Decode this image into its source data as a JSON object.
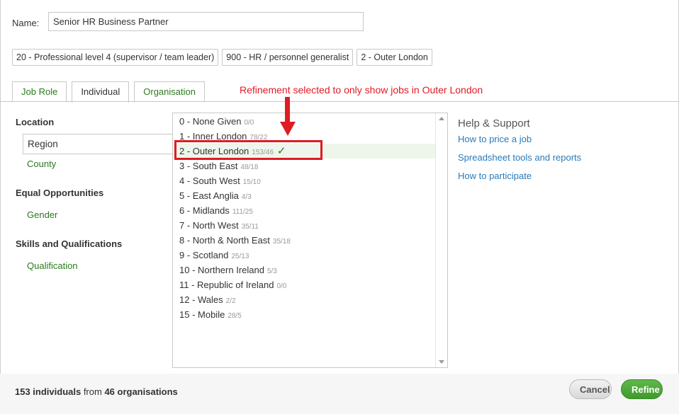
{
  "name_field": {
    "label": "Name:",
    "value": "Senior HR Business Partner"
  },
  "chips": [
    "20 - Professional level 4 (supervisor / team leader)",
    "900 - HR / personnel generalist",
    "2 - Outer London"
  ],
  "tabs": [
    {
      "label": "Job Role",
      "active": false
    },
    {
      "label": "Individual",
      "active": true
    },
    {
      "label": "Organisation",
      "active": false
    }
  ],
  "annotation": "Refinement selected to only show jobs in Outer London",
  "filters": {
    "location_heading": "Location",
    "region": "Region",
    "county": "County",
    "equal_heading": "Equal Opportunities",
    "gender": "Gender",
    "skills_heading": "Skills and Qualifications",
    "qualification": "Qualification"
  },
  "regions": [
    {
      "label": "0 - None Given",
      "count": "0/0",
      "selected": false
    },
    {
      "label": "1 - Inner London",
      "count": "78/22",
      "selected": false
    },
    {
      "label": "2 - Outer London",
      "count": "153/46",
      "selected": true
    },
    {
      "label": "3 - South East",
      "count": "48/18",
      "selected": false
    },
    {
      "label": "4 - South West",
      "count": "15/10",
      "selected": false
    },
    {
      "label": "5 - East Anglia",
      "count": "4/3",
      "selected": false
    },
    {
      "label": "6 - Midlands",
      "count": "111/25",
      "selected": false
    },
    {
      "label": "7 - North West",
      "count": "35/11",
      "selected": false
    },
    {
      "label": "8 - North & North East",
      "count": "35/18",
      "selected": false
    },
    {
      "label": "9 - Scotland",
      "count": "25/13",
      "selected": false
    },
    {
      "label": "10 - Northern Ireland",
      "count": "5/3",
      "selected": false
    },
    {
      "label": "11 - Republic of Ireland",
      "count": "0/0",
      "selected": false
    },
    {
      "label": "12 - Wales",
      "count": "2/2",
      "selected": false
    },
    {
      "label": "15 - Mobile",
      "count": "28/5",
      "selected": false
    }
  ],
  "help": {
    "title": "Help & Support",
    "links": [
      "How to price a job",
      "Spreadsheet tools and reports",
      "How to participate"
    ]
  },
  "footer": {
    "individuals": "153 individuals",
    "from_text": " from ",
    "organisations": "46 organisations",
    "cancel_label": "Cancel",
    "refine_label": "Refine"
  },
  "colors": {
    "accent_green": "#2c7a1e",
    "link_blue": "#2a7ab8",
    "annotation_red": "#e01b24"
  }
}
